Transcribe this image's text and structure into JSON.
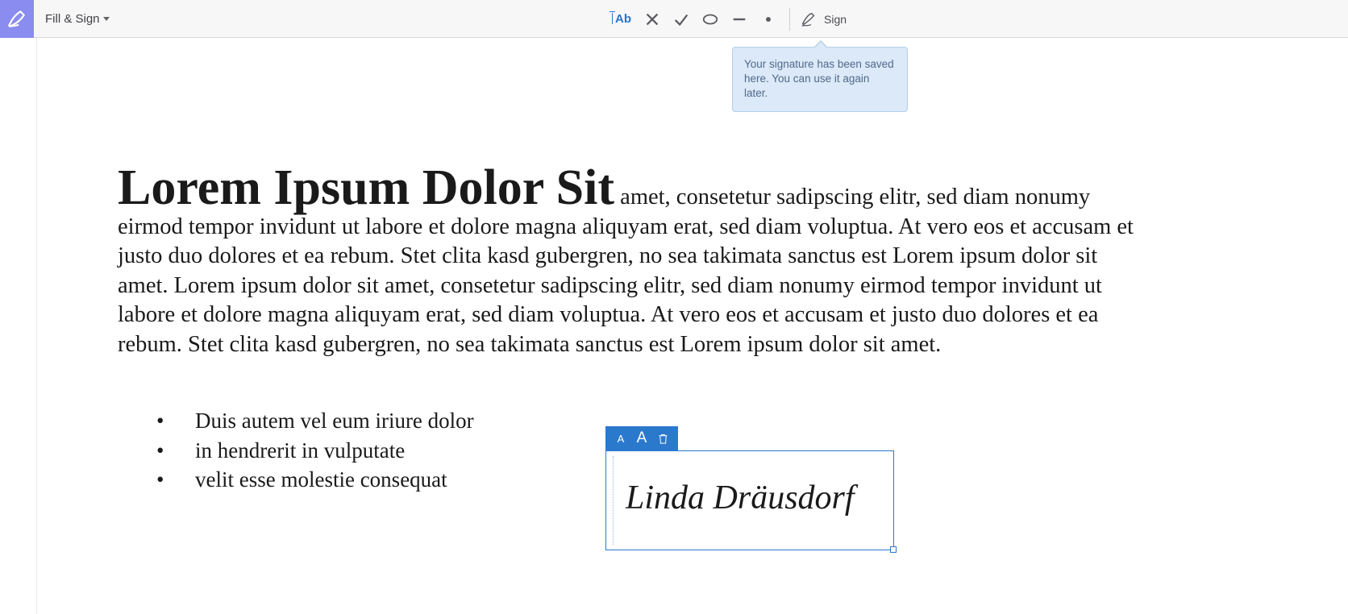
{
  "toolbar": {
    "menu_label": "Fill & Sign",
    "tool_ab": "Ab",
    "sign_label": "Sign"
  },
  "tooltip": {
    "text": "Your signature has been saved here. You can use it again later."
  },
  "document": {
    "heading": "Lorem Ipsum Dolor Sit",
    "body": " amet, consetetur sadipscing elitr, sed diam nonumy eirmod tempor invidunt ut labore et dolore magna aliquyam erat, sed diam voluptua. At vero eos et accusam et justo duo dolores et ea rebum. Stet clita kasd gubergren, no sea takimata sanctus est Lorem ipsum dolor sit amet. Lorem ipsum dolor sit amet, consetetur sadipscing elitr, sed diam nonumy eirmod tempor invidunt ut labore et dolore magna aliquyam erat, sed diam voluptua. At vero eos et accusam et justo duo dolores et ea rebum. Stet clita kasd gubergren, no sea takimata sanctus est Lorem ipsum dolor sit amet.",
    "list": [
      "Duis autem vel eum iriure dolor",
      "in hendrerit in vulputate",
      "velit esse molestie consequat"
    ]
  },
  "signature": {
    "small_a": "A",
    "big_a": "A",
    "text": "Linda Dräusdorf"
  }
}
